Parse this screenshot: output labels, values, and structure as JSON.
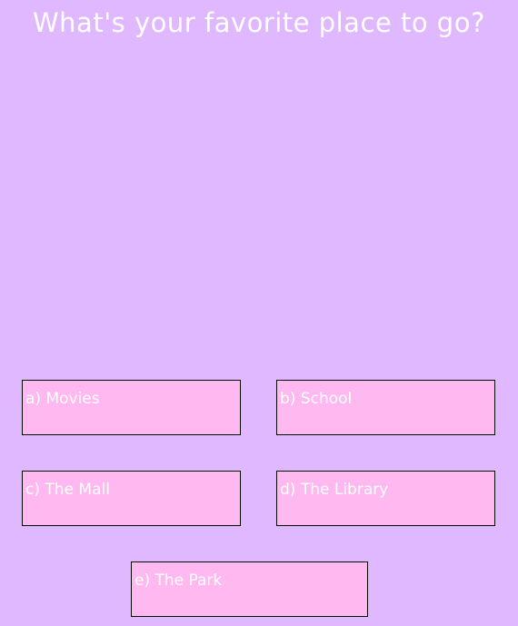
{
  "question": "What's your favorite place to go?",
  "answers": [
    {
      "label": "a) Movies"
    },
    {
      "label": "b) School"
    },
    {
      "label": "c) The Mall"
    },
    {
      "label": "d) The Library"
    },
    {
      "label": "e) The Park"
    }
  ],
  "colors": {
    "background": "#e0b8ff",
    "answer_fill": "#ffb8f0",
    "answer_border": "#000000",
    "text": "#ffffff"
  }
}
